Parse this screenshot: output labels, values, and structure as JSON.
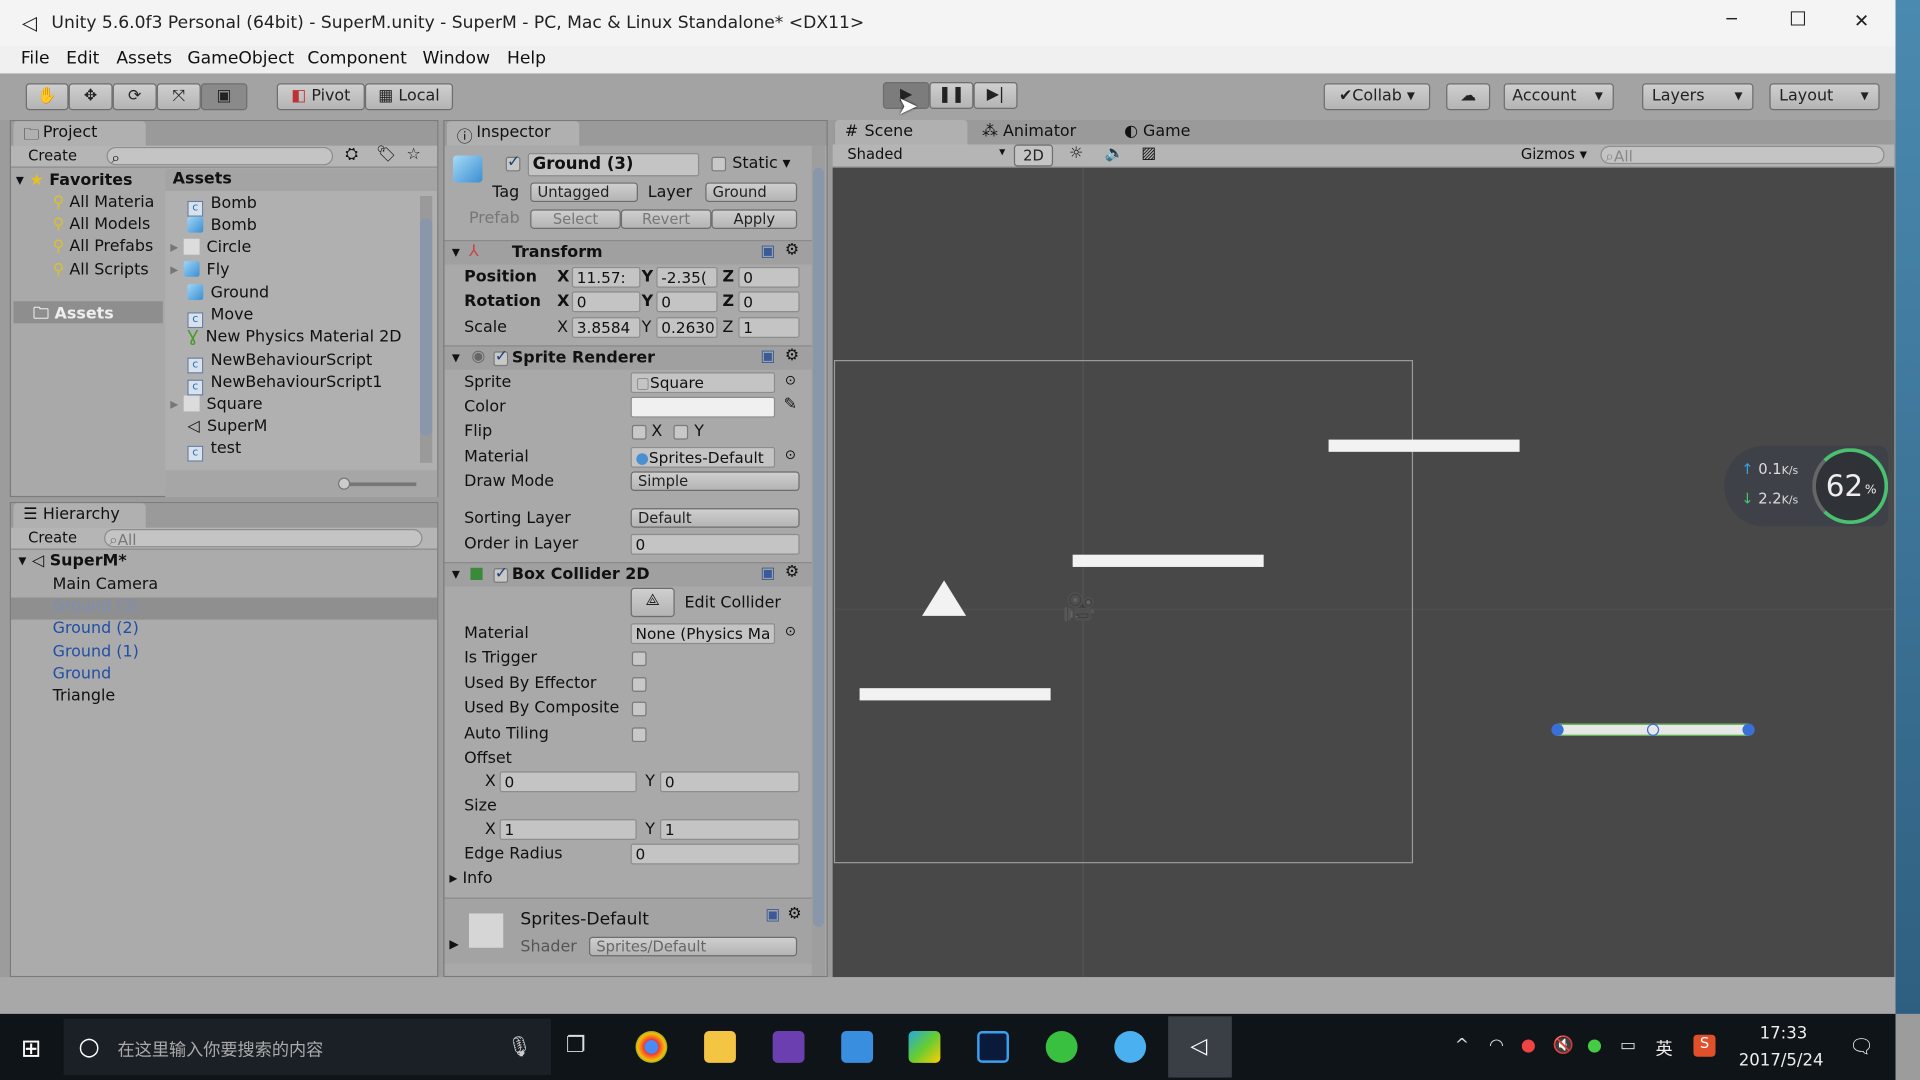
{
  "window": {
    "title": "Unity 5.6.0f3 Personal (64bit) - SuperM.unity - SuperM - PC, Mac & Linux Standalone* <DX11>",
    "minimize": "─",
    "maximize": "☐",
    "close": "✕"
  },
  "menu": [
    "File",
    "Edit",
    "Assets",
    "GameObject",
    "Component",
    "Window",
    "Help"
  ],
  "toolbar": {
    "pivot": "Pivot",
    "local": "Local",
    "collab": "Collab",
    "account": "Account",
    "layers": "Layers",
    "layout": "Layout"
  },
  "project": {
    "tab": "Project",
    "create": "Create",
    "favorites_label": "Favorites",
    "favorites": [
      "All Materia",
      "All Models",
      "All Prefabs",
      "All Scripts"
    ],
    "assets_folder": "Assets",
    "assets_header": "Assets",
    "items": [
      {
        "name": "Bomb",
        "icon": "script"
      },
      {
        "name": "Bomb",
        "icon": "prefab"
      },
      {
        "name": "Circle",
        "icon": "sprite"
      },
      {
        "name": "Fly",
        "icon": "prefab"
      },
      {
        "name": "Ground",
        "icon": "prefab"
      },
      {
        "name": "Move",
        "icon": "script"
      },
      {
        "name": "New Physics Material 2D",
        "icon": "physics-material"
      },
      {
        "name": "NewBehaviourScript",
        "icon": "script"
      },
      {
        "name": "NewBehaviourScript1",
        "icon": "script"
      },
      {
        "name": "Square",
        "icon": "sprite"
      },
      {
        "name": "SuperM",
        "icon": "unity-scene"
      },
      {
        "name": "test",
        "icon": "script"
      }
    ]
  },
  "hierarchy": {
    "tab": "Hierarchy",
    "create": "Create",
    "search_placeholder": "All",
    "scene": "SuperM*",
    "items": [
      "Main Camera",
      "Ground (3)",
      "Ground (2)",
      "Ground (1)",
      "Ground",
      "Triangle"
    ],
    "selected": "Ground (3)"
  },
  "inspector": {
    "tab": "Inspector",
    "object_name": "Ground (3)",
    "static_label": "Static",
    "tag_label": "Tag",
    "tag": "Untagged",
    "layer_label": "Layer",
    "layer": "Ground",
    "prefab_label": "Prefab",
    "select": "Select",
    "revert": "Revert",
    "apply": "Apply",
    "transform": {
      "title": "Transform",
      "position_label": "Position",
      "position": {
        "x": "11.57:",
        "y": "-2.35(",
        "z": "0"
      },
      "rotation_label": "Rotation",
      "rotation": {
        "x": "0",
        "y": "0",
        "z": "0"
      },
      "scale_label": "Scale",
      "scale": {
        "x": "3.8584",
        "y": "0.2630",
        "z": "1"
      }
    },
    "sprite_renderer": {
      "title": "Sprite Renderer",
      "sprite_label": "Sprite",
      "sprite": "Square",
      "color_label": "Color",
      "color": "#f0f0f0",
      "flip_label": "Flip",
      "flip_x": "X",
      "flip_y": "Y",
      "material_label": "Material",
      "material": "Sprites-Default",
      "draw_mode_label": "Draw Mode",
      "draw_mode": "Simple",
      "sorting_layer_label": "Sorting Layer",
      "sorting_layer": "Default",
      "order_label": "Order in Layer",
      "order": "0"
    },
    "box_collider": {
      "title": "Box Collider 2D",
      "edit_collider": "Edit Collider",
      "material_label": "Material",
      "material": "None (Physics Ma",
      "is_trigger": "Is Trigger",
      "used_by_effector": "Used By Effector",
      "used_by_composite": "Used By Composite",
      "auto_tiling": "Auto Tiling",
      "offset_label": "Offset",
      "offset": {
        "x": "0",
        "y": "0"
      },
      "size_label": "Size",
      "size": {
        "x": "1",
        "y": "1"
      },
      "edge_radius_label": "Edge Radius",
      "edge_radius": "0",
      "info": "Info"
    },
    "material_asset": {
      "name": "Sprites-Default",
      "shader_label": "Shader",
      "shader": "Sprites/Default"
    }
  },
  "scene": {
    "tabs": [
      "Scene",
      "Animator",
      "Game"
    ],
    "shading": "Shaded",
    "mode_2d": "2D",
    "gizmos": "Gizmos",
    "search_placeholder": "All"
  },
  "network_widget": {
    "upload": "0.1",
    "upload_unit": "K/s",
    "download": "2.2",
    "download_unit": "K/s",
    "percent": "62",
    "percent_unit": "%"
  },
  "taskbar": {
    "search_placeholder": "在这里输入你要搜索的内容",
    "ime": "英",
    "time": "17:33",
    "date": "2017/5/24"
  }
}
